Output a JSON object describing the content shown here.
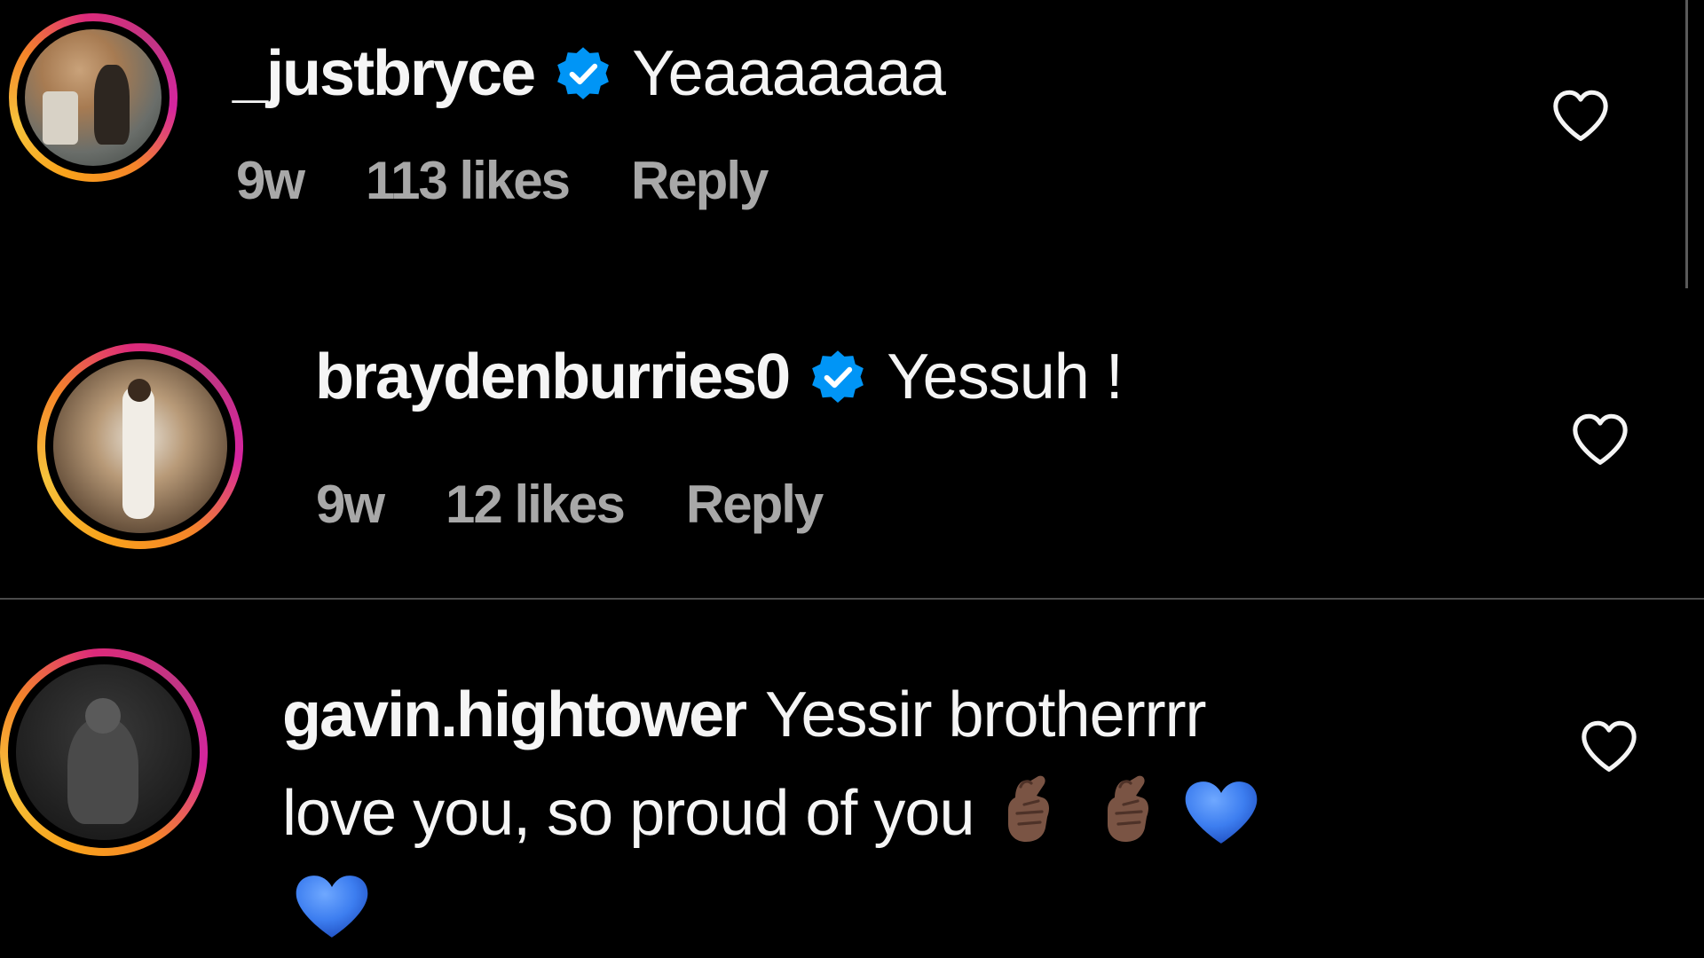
{
  "comments": [
    {
      "username": "_justbryce",
      "verified": true,
      "text": "Yeaaaaaaa",
      "age": "9w",
      "likes": "113 likes",
      "reply_label": "Reply"
    },
    {
      "username": "braydenburries0",
      "verified": true,
      "text": "Yessuh !",
      "age": "9w",
      "likes": "12 likes",
      "reply_label": "Reply"
    },
    {
      "username": "gavin.hightower",
      "verified": false,
      "text_line1": "Yessir brotherrrr",
      "text_line2": "love you, so proud of you",
      "emojis": [
        "crossed-fingers-medium-dark",
        "crossed-fingers-medium-dark",
        "blue-heart",
        "blue-heart"
      ]
    }
  ],
  "icons": {
    "verified": "verified-badge-icon",
    "like": "heart-outline-icon"
  },
  "colors": {
    "background": "#000000",
    "text_primary": "#f5f5f5",
    "text_secondary": "#a8a8a8",
    "verified_blue": "#0095f6",
    "emoji_heart_blue": "#3d7ef0"
  }
}
